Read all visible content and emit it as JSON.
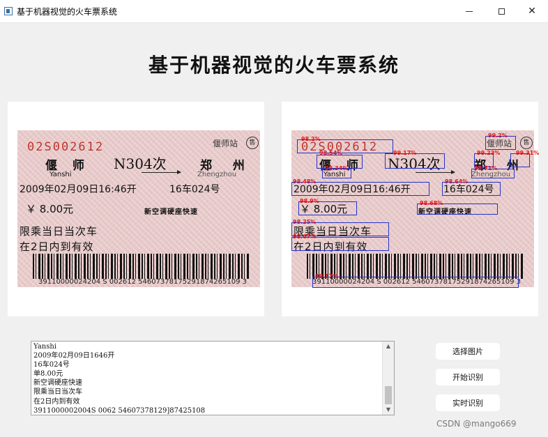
{
  "window": {
    "title": "基于机器视觉的火车票系统",
    "minimize_icon": "minimize-icon",
    "maximize_icon": "maximize-icon",
    "close_glyph": "✕"
  },
  "main_title": "基于机器视觉的火车票系统",
  "ticket": {
    "code": "02S002612",
    "station_office": "偃师站",
    "seal": "售",
    "from_cn": "偃 师",
    "from_en": "Yanshi",
    "train_no": "N304次",
    "to_cn": "郑 州",
    "to_en": "Zhengzhou",
    "datetime": "2009年02月09日16:46开",
    "seat": "16车024号",
    "price": "￥ 8.00元",
    "seat_type": "新空调硬座快速",
    "limit": "限乘当日当次车",
    "validity": "在2日内到有效",
    "barcode_number": "39110000024204  S 002612  54607378175291874265109 3"
  },
  "detections": {
    "confidences": [
      "98.2%",
      "98.54%",
      "99.17%",
      "99.23%",
      "99.31%",
      "99.2%",
      "98.34%",
      "98.71%",
      "98.48%",
      "98.64%",
      "98.9%",
      "98.68%",
      "98.25%",
      "98.67%",
      "98.17%"
    ]
  },
  "log": {
    "lines": [
      "Yanshi",
      "2009年02月09日1646开",
      "16车024号",
      "单8.00元",
      "新空调硬座快速",
      "限乘当日当次车",
      "在2日内到有效",
      "3911000002004S 0062 54607378129]87425108"
    ],
    "scroll_up": "▲",
    "scroll_down": "▼"
  },
  "buttons": {
    "select_image": "选择图片",
    "start_recognition": "开始识别",
    "live_recognition": "实时识别"
  },
  "watermark": "CSDN @mango669",
  "colors": {
    "box": "#2233cc",
    "confidence": "#e01616",
    "ticket_code": "#c0342d"
  }
}
